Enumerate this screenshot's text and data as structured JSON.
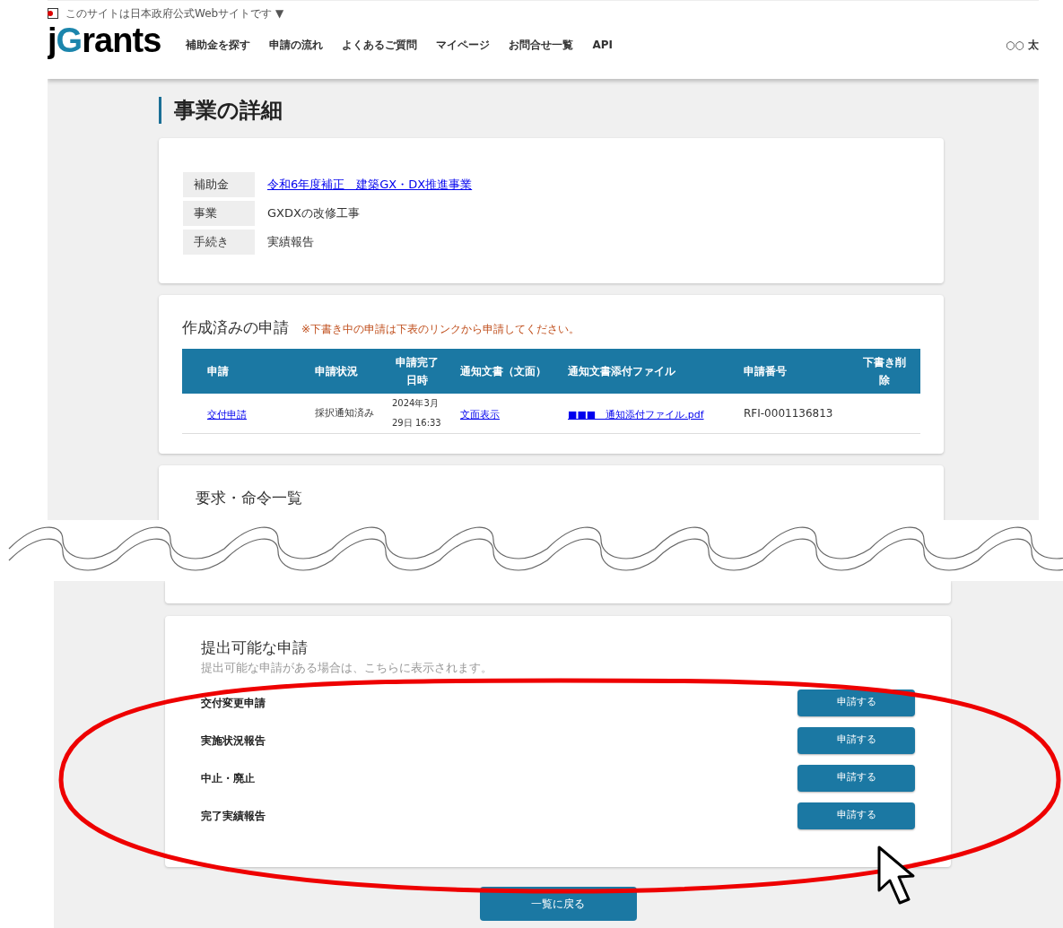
{
  "gov_banner": {
    "text": "このサイトは日本政府公式Webサイトです ▼"
  },
  "header": {
    "logo": "jGrants",
    "nav": [
      "補助金を探す",
      "申請の流れ",
      "よくあるご質問",
      "マイページ",
      "お問合せ一覧",
      "API"
    ],
    "user": "○○ 太"
  },
  "page_title": "事業の詳細",
  "summary": [
    {
      "label": "補助金",
      "value": "令和6年度補正　建築GX・DX推進事業",
      "kind": "link"
    },
    {
      "label": "事業",
      "value": "GXDXの改修工事",
      "kind": "text"
    },
    {
      "label": "手続き",
      "value": "実績報告",
      "kind": "text"
    }
  ],
  "applications": {
    "title": "作成済みの申請",
    "note": "※下書き中の申請は下表のリンクから申請してください。",
    "columns": [
      "申請",
      "申請状況",
      "申請完了日時",
      "通知文書（文面）",
      "通知文書添付ファイル",
      "申請番号",
      "下書き削除"
    ],
    "rows": [
      {
        "cells": [
          {
            "text": "交付申請",
            "kind": "link"
          },
          {
            "text": "採択通知済み",
            "kind": "text"
          },
          {
            "text": "2024年3月29日 16:33",
            "kind": "text"
          },
          {
            "text": "文面表示",
            "kind": "link"
          },
          {
            "text": "■■■　通知添付ファイル.pdf",
            "kind": "link"
          },
          {
            "text": "RFI-0001136813",
            "kind": "text"
          }
        ]
      }
    ]
  },
  "requests": {
    "title": "要求・命令一覧"
  },
  "submittable": {
    "title": "提出可能な申請",
    "description": "提出可能な申請がある場合は、こちらに表示されます。",
    "items": [
      {
        "name": "交付変更申請",
        "button": "申請する"
      },
      {
        "name": "実施状況報告",
        "button": "申請する"
      },
      {
        "name": "中止・廃止",
        "button": "申請する"
      },
      {
        "name": "完了実績報告",
        "button": "申請する"
      }
    ]
  },
  "back_button": "一覧に戻る"
}
